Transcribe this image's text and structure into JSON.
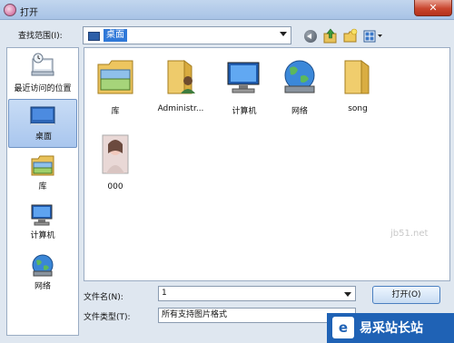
{
  "window": {
    "title": "打开",
    "close_label": "✕"
  },
  "lookin": {
    "label": "查找范围(I):",
    "value": "桌面"
  },
  "places": [
    {
      "label": "最近访问的位置",
      "icon": "recent-places-icon"
    },
    {
      "label": "桌面",
      "icon": "desktop-icon",
      "active": true
    },
    {
      "label": "库",
      "icon": "libraries-icon"
    },
    {
      "label": "计算机",
      "icon": "computer-icon"
    },
    {
      "label": "网络",
      "icon": "network-icon"
    }
  ],
  "files": [
    {
      "label": "库",
      "icon": "libraries-folder-icon"
    },
    {
      "label": "Administr...",
      "icon": "user-folder-icon"
    },
    {
      "label": "计算机",
      "icon": "computer-icon"
    },
    {
      "label": "网络",
      "icon": "network-icon"
    },
    {
      "label": "song",
      "icon": "folder-icon"
    },
    {
      "label": "000",
      "icon": "image-thumbnail-icon"
    }
  ],
  "filename": {
    "label": "文件名(N):",
    "value": "1"
  },
  "filetype": {
    "label": "文件类型(T):",
    "value": "所有支持图片格式"
  },
  "buttons": {
    "open": "打开(O)"
  },
  "watermark": {
    "brand": "易采站长站",
    "logo_glyph": "e",
    "url": "jb51.net"
  },
  "colors": {
    "selection": "#3079d8",
    "title_bar": "#b5cde9",
    "close": "#c9462e"
  }
}
